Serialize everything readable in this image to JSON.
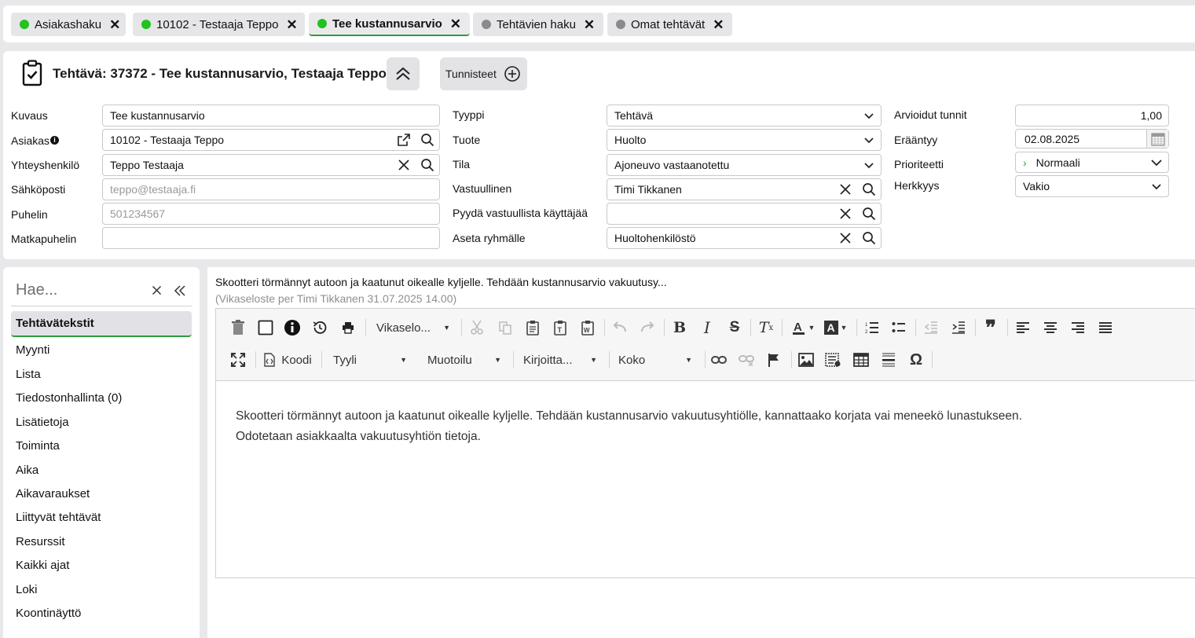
{
  "tabs": [
    {
      "label": "Asiakashaku",
      "status": "green"
    },
    {
      "label": "10102 - Testaaja Teppo",
      "status": "green"
    },
    {
      "label": "Tee kustannusarvio",
      "status": "green",
      "active": true
    },
    {
      "label": "Tehtävien haku",
      "status": "gray"
    },
    {
      "label": "Omat tehtävät",
      "status": "gray"
    }
  ],
  "header": {
    "title": "Tehtävä: 37372 - Tee kustannusarvio, Testaaja Teppo",
    "tags_label": "Tunnisteet"
  },
  "form": {
    "kuvaus": {
      "label": "Kuvaus",
      "value": "Tee kustannusarvio"
    },
    "asiakas": {
      "label": "Asiakas",
      "value": "10102 - Testaaja Teppo"
    },
    "yhteyshenkilo": {
      "label": "Yhteyshenkilö",
      "value": "Teppo Testaaja"
    },
    "sahkoposti": {
      "label": "Sähköposti",
      "placeholder": "teppo@testaaja.fi"
    },
    "puhelin": {
      "label": "Puhelin",
      "placeholder": "501234567"
    },
    "matkapuhelin": {
      "label": "Matkapuhelin",
      "value": ""
    },
    "tyyppi": {
      "label": "Tyyppi",
      "value": "Tehtävä"
    },
    "tuote": {
      "label": "Tuote",
      "value": "Huolto"
    },
    "tila": {
      "label": "Tila",
      "value": "Ajoneuvo vastaanotettu"
    },
    "vastuullinen": {
      "label": "Vastuullinen",
      "value": "Timi Tikkanen"
    },
    "pyyda": {
      "label": "Pyydä vastuullista käyttäjää",
      "value": ""
    },
    "ryhma": {
      "label": "Aseta ryhmälle",
      "value": "Huoltohenkilöstö"
    },
    "arvioidut": {
      "label": "Arvioidut tunnit",
      "value": "1,00"
    },
    "eraantyy": {
      "label": "Erääntyy",
      "value": "02.08.2025"
    },
    "prioriteetti": {
      "label": "Prioriteetti",
      "value": "Normaali"
    },
    "herkkyys": {
      "label": "Herkkyys",
      "value": "Vakio"
    }
  },
  "sidebar": {
    "search_placeholder": "Hae...",
    "items": [
      {
        "label": "Tehtävätekstit",
        "active": true
      },
      {
        "label": "Myynti"
      },
      {
        "label": "Lista"
      },
      {
        "label": "Tiedostonhallinta (0)"
      },
      {
        "label": "Lisätietoja"
      },
      {
        "label": "Toiminta"
      },
      {
        "label": "Aika"
      },
      {
        "label": "Aikavaraukset"
      },
      {
        "label": "Liittyvät tehtävät"
      },
      {
        "label": "Resurssit"
      },
      {
        "label": "Kaikki ajat"
      },
      {
        "label": "Loki"
      },
      {
        "label": "Koontinäyttö"
      }
    ]
  },
  "main": {
    "summary": "Skootteri törmännyt autoon ja kaatunut oikealle kyljelle. Tehdään kustannusarvio vakuutusy...",
    "meta": "(Vikaseloste per Timi Tikkanen 31.07.2025 14.00)",
    "toolbar": {
      "template": "Vikaselo...",
      "code": "Koodi",
      "style": "Tyyli",
      "format": "Muotoilu",
      "font": "Kirjoitta...",
      "size": "Koko"
    },
    "content_line1": "Skootteri törmännyt autoon ja kaatunut oikealle kyljelle. Tehdään kustannusarvio vakuutusyhtiölle, kannattaako korjata vai meneekö lunastukseen.",
    "content_line2": "Odotetaan asiakkaalta vakuutusyhtiön tietoja."
  },
  "colors": {
    "status_green": "#23c21f",
    "status_gray": "#8a8a8a",
    "accent": "#2e9b3c"
  }
}
